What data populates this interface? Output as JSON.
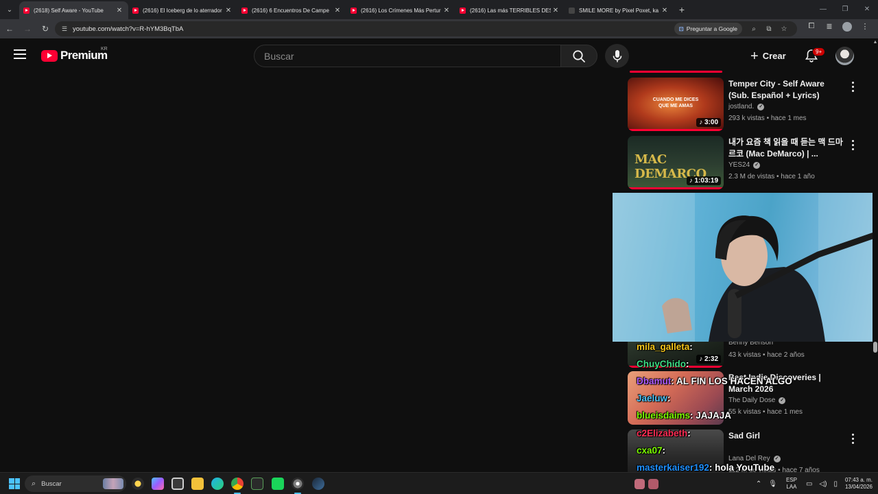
{
  "browser": {
    "tabs": [
      {
        "title": "(2618) Self Aware - YouTube",
        "active": true,
        "icon": "youtube-icon"
      },
      {
        "title": "(2616) El Iceberg de lo aterrador",
        "active": false,
        "icon": "youtube-icon"
      },
      {
        "title": "(2616) 6 Encuentros De Campe",
        "active": false,
        "icon": "youtube-icon"
      },
      {
        "title": "(2616) Los Crímenes Más Pertur",
        "active": false,
        "icon": "youtube-icon"
      },
      {
        "title": "(2616) Las más TERRIBLES DESA",
        "active": false,
        "icon": "youtube-icon"
      },
      {
        "title": "SMILE MORE by Pixel Poxet, ka",
        "active": false,
        "icon": "page-icon"
      }
    ],
    "url": "youtube.com/watch?v=R-hYM3BqTbA",
    "ask_google_label": "Preguntar a Google"
  },
  "youtube": {
    "logo_text": "Premium",
    "region": "KR",
    "search_placeholder": "Buscar",
    "create_label": "Crear",
    "notification_count": "9+"
  },
  "recommendations": [
    {
      "title": "Temper City - Self Aware (Sub. Español + Lyrics)",
      "channel": "jostland.",
      "verified": true,
      "meta": "293 k vistas • hace 1 mes",
      "duration": "3:00",
      "music": true
    },
    {
      "title": "내가 요즘 책 읽을 때 듣는 맥 드마르코 (Mac DeMarco) | ...",
      "channel": "YES24",
      "verified": true,
      "meta": "2.3 M de vistas • hace 1 año",
      "duration": "1:03:19",
      "music": true
    },
    {
      "title": "",
      "channel": "Benny Benson",
      "verified": false,
      "meta": "43 k vistas • hace 2 años",
      "duration": "2:32",
      "music": true
    },
    {
      "title": "Best Indie Discoveries | March 2026",
      "channel": "The Daily Dose",
      "verified": true,
      "meta": "55 k vistas • hace 1 mes",
      "duration": "",
      "music": false
    },
    {
      "title": "Sad Girl",
      "channel": "Lana Del Rey",
      "verified": true,
      "meta": "112 M de vistas • hace 7 años",
      "duration": "",
      "music": false
    }
  ],
  "thumb_texts": {
    "temper_city": "CUANDO ME DICES QUE ME AMAS",
    "mac_demarco": "MAC DEMARCO"
  },
  "chat": [
    {
      "user": "mila_galleta",
      "message": ":",
      "color": "#f5c518"
    },
    {
      "user": "ChuyChido",
      "message": ":",
      "color": "#3ddc84"
    },
    {
      "user": "Dbamut",
      "message": ": AL FIN LOS HACEN ALGO",
      "color": "#b05cff"
    },
    {
      "user": "Jaeluw",
      "message": ":",
      "color": "#4fc3f7"
    },
    {
      "user": "blueisdaims",
      "message": ": JAJAJA",
      "color": "#7cfc00"
    },
    {
      "user": "c2Elizabeth",
      "message": ":",
      "color": "#ff2d55"
    },
    {
      "user": "cxa07",
      "message": ":",
      "color": "#7cfc00"
    },
    {
      "user": "masterkaiser192",
      "message": ": hola YouTube",
      "color": "#1e90ff"
    }
  ],
  "taskbar": {
    "search_placeholder": "Buscar",
    "lang_top": "ESP",
    "lang_bottom": "LAA",
    "time": "07:43 a. m.",
    "date": "13/04/2026"
  },
  "colors": {
    "youtube_red": "#ff0033",
    "background": "#0f0f0f",
    "accent_blue": "#4cc2ff"
  }
}
